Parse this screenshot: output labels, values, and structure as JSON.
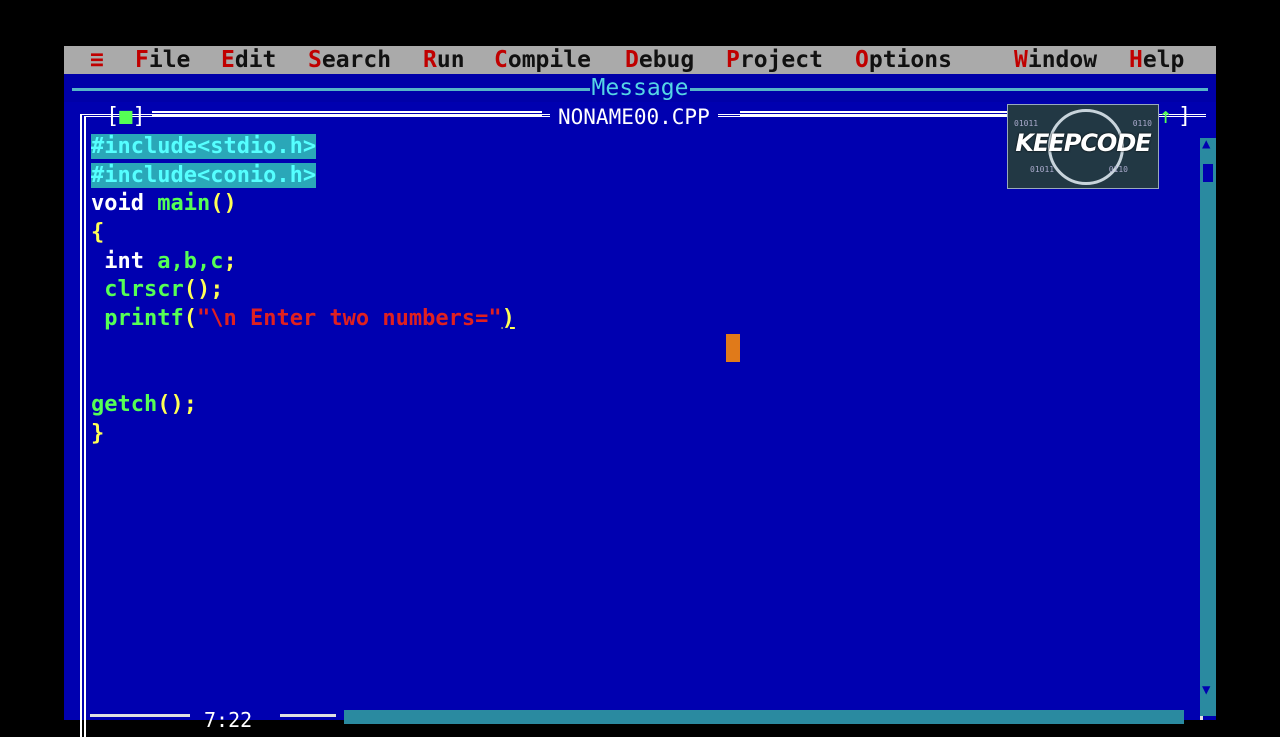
{
  "menubar": {
    "system_icon": "≡",
    "items": [
      {
        "hot": "F",
        "rest": "ile"
      },
      {
        "hot": "E",
        "rest": "dit"
      },
      {
        "hot": "S",
        "rest": "earch"
      },
      {
        "hot": "R",
        "rest": "un"
      },
      {
        "hot": "C",
        "rest": "ompile"
      },
      {
        "hot": "D",
        "rest": "ebug"
      },
      {
        "hot": "P",
        "rest": "roject"
      },
      {
        "hot": "O",
        "rest": "ptions"
      },
      {
        "hot": "W",
        "rest": "indow"
      },
      {
        "hot": "H",
        "rest": "elp"
      }
    ]
  },
  "message_window": {
    "title": "Message"
  },
  "editor_window": {
    "title": "NONAME00.CPP",
    "close_box": "■",
    "resize_icon": "↑",
    "cursor_position": "7:22"
  },
  "code": {
    "l1": "#include<stdio.h>",
    "l2": "#include<conio.h>",
    "l3_kw": "void",
    "l3_id": "main",
    "l3_p": "()",
    "l4": "{",
    "l5_kw": "int",
    "l5_ids": "a,b,c",
    "l5_p": ";",
    "l6_id": "clrscr",
    "l6_p": "();",
    "l7_id": "printf",
    "l7_p1": "(",
    "l7_str": "\"\\n Enter two numbers=\"",
    "l7_p2": ")",
    "l10_id": "getch",
    "l10_p": "();",
    "l11": "}"
  },
  "watermark": {
    "text": "KEEPCODE",
    "bits_left": "01011",
    "bits_right": "0110"
  },
  "colors": {
    "editor_bg": "#0000b0",
    "menubar_bg": "#aaaaaa",
    "hotkey": "#c00000",
    "cursor": "#e07a1a",
    "string": "#e02020",
    "identifier": "#55ff55",
    "keyword": "#ffffff"
  }
}
